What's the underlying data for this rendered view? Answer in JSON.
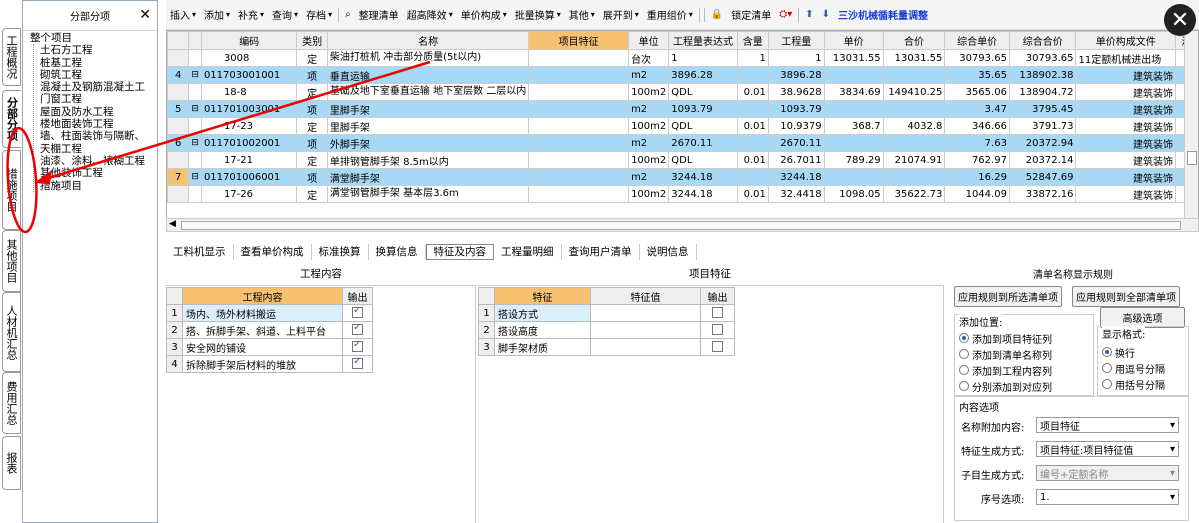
{
  "vertical_tabs": [
    "工程概况",
    "分部分项",
    "措施项目",
    "其他项目",
    "人材机汇总",
    "费用汇总",
    "报表"
  ],
  "tree": {
    "title": "分部分项",
    "root": "整个项目",
    "items": [
      "土石方工程",
      "桩基工程",
      "砌筑工程",
      "混凝土及钢筋混凝土工",
      "门窗工程",
      "屋面及防水工程",
      "楼地面装饰工程",
      "墙、柱面装饰与隔断、",
      "天棚工程",
      "油漆、涂料、裱糊工程",
      "其他装饰工程",
      "措施项目"
    ]
  },
  "toolbar": [
    "插入",
    "添加",
    "补充",
    "查询",
    "存档",
    "整理清单",
    "超高降效",
    "单价构成",
    "批量换算",
    "其他",
    "展开到",
    "重用组价",
    "锁定清单"
  ],
  "toolbar_special": "三沙机械循耗量调整",
  "grid": {
    "columns": [
      "",
      "",
      "编码",
      "类别",
      "名称",
      "项目特征",
      "单位",
      "工程量表达式",
      "含量",
      "工程量",
      "单价",
      "合价",
      "综合单价",
      "综合合价",
      "单价构成文件",
      "汇"
    ],
    "rows": [
      {
        "n": "",
        "code": "3008",
        "cat": "定",
        "name": "柴油打桩机 冲击部分质量(5t以内)",
        "feat": "",
        "unit": "台次",
        "expr": "1",
        "cnt": "1",
        "qty": "1",
        "price": "13031.55",
        "total": "13031.55",
        "uprice": "30793.65",
        "utotal": "30793.65",
        "file": "11定额机械进出场",
        "type": "sub2"
      },
      {
        "n": "4",
        "code": "011703001001",
        "cat": "项",
        "name": "垂直运输",
        "feat": "",
        "unit": "m2",
        "expr": "3896.28",
        "cnt": "",
        "qty": "3896.28",
        "price": "",
        "total": "",
        "uprice": "35.65",
        "utotal": "138902.38",
        "file": "建筑装饰",
        "type": "main"
      },
      {
        "n": "",
        "code": "18-8",
        "cat": "定",
        "name": "基础及地下室垂直运输 地下室层数 二层以内",
        "feat": "",
        "unit": "100m2",
        "expr": "QDL",
        "cnt": "0.01",
        "qty": "38.9628",
        "price": "3834.69",
        "total": "149410.25",
        "uprice": "3565.06",
        "utotal": "138904.72",
        "file": "建筑装饰",
        "type": "sub2"
      },
      {
        "n": "5",
        "code": "011701003001",
        "cat": "项",
        "name": "里脚手架",
        "feat": "",
        "unit": "m2",
        "expr": "1093.79",
        "cnt": "",
        "qty": "1093.79",
        "price": "",
        "total": "",
        "uprice": "3.47",
        "utotal": "3795.45",
        "file": "建筑装饰",
        "type": "main"
      },
      {
        "n": "",
        "code": "17-23",
        "cat": "定",
        "name": "里脚手架",
        "feat": "",
        "unit": "100m2",
        "expr": "QDL",
        "cnt": "0.01",
        "qty": "10.9379",
        "price": "368.7",
        "total": "4032.8",
        "uprice": "346.66",
        "utotal": "3791.73",
        "file": "建筑装饰",
        "type": "sub"
      },
      {
        "n": "6",
        "code": "011701002001",
        "cat": "项",
        "name": "外脚手架",
        "feat": "",
        "unit": "m2",
        "expr": "2670.11",
        "cnt": "",
        "qty": "2670.11",
        "price": "",
        "total": "",
        "uprice": "7.63",
        "utotal": "20372.94",
        "file": "建筑装饰",
        "type": "main"
      },
      {
        "n": "",
        "code": "17-21",
        "cat": "定",
        "name": "单排钢管脚手架 8.5m以内",
        "feat": "",
        "unit": "100m2",
        "expr": "QDL",
        "cnt": "0.01",
        "qty": "26.7011",
        "price": "789.29",
        "total": "21074.91",
        "uprice": "762.97",
        "utotal": "20372.14",
        "file": "建筑装饰",
        "type": "sub"
      },
      {
        "n": "7",
        "code": "011701006001",
        "cat": "项",
        "name": "满堂脚手架",
        "feat": "",
        "unit": "m2",
        "expr": "3244.18",
        "cnt": "",
        "qty": "3244.18",
        "price": "",
        "total": "",
        "uprice": "16.29",
        "utotal": "52847.69",
        "file": "建筑装饰",
        "type": "selected"
      },
      {
        "n": "",
        "code": "17-26",
        "cat": "定",
        "name": "满堂钢管脚手架 基本层3.6m",
        "feat": "",
        "unit": "100m2",
        "expr": "3244.18",
        "cnt": "0.01",
        "qty": "32.4418",
        "price": "1098.05",
        "total": "35622.73",
        "uprice": "1044.09",
        "utotal": "33872.16",
        "file": "建筑装饰",
        "type": "sub2"
      }
    ]
  },
  "bottom_tabs": [
    "工料机显示",
    "查看单价构成",
    "标准换算",
    "换算信息",
    "特征及内容",
    "工程量明细",
    "查询用户清单",
    "说明信息"
  ],
  "work_content": {
    "title": "工程内容",
    "headers": [
      "工程内容",
      "输出"
    ],
    "rows": [
      "场内、场外材料搬运",
      "搭、拆脚手架、斜道、上料平台",
      "安全网的铺设",
      "拆除脚手架后材料的堆放"
    ]
  },
  "features": {
    "title": "项目特征",
    "headers": [
      "特征",
      "特征值",
      "输出"
    ],
    "rows": [
      "搭设方式",
      "搭设高度",
      "脚手架材质"
    ]
  },
  "options": {
    "title": "清单名称显示规则",
    "btn_apply_selected": "应用规则到所选清单项",
    "btn_apply_all": "应用规则到全部清单项",
    "btn_advanced": "高级选项",
    "add_position_label": "添加位置:",
    "add_positions": [
      "添加到项目特征列",
      "添加到清单名称列",
      "添加到工程内容列",
      "分别添加到对应列"
    ],
    "format_label": "显示格式:",
    "formats": [
      "换行",
      "用逗号分隔",
      "用括号分隔"
    ],
    "content_label": "内容选项",
    "name_append_label": "名称附加内容:",
    "name_append_value": "项目特征",
    "feature_gen_label": "特征生成方式:",
    "feature_gen_value": "项目特征:项目特征值",
    "child_gen_label": "子目生成方式:",
    "child_gen_value": "编号+定额名称",
    "seq_label": "序号选项:",
    "seq_value": "1."
  }
}
